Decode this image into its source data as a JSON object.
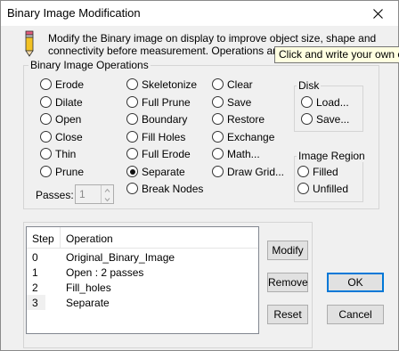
{
  "window": {
    "title": "Binary Image Modification"
  },
  "description": {
    "line1": "Modify the Binary image on display to improve object size, shape and",
    "line2": "connectivity before measurement. Operations are auto"
  },
  "tooltip": {
    "text": "Click and write your own c"
  },
  "operations": {
    "label": "Binary Image Operations",
    "col1": [
      "Erode",
      "Dilate",
      "Open",
      "Close",
      "Thin",
      "Prune"
    ],
    "col2": [
      "Skeletonize",
      "Full Prune",
      "Boundary",
      "Fill Holes",
      "Full Erode",
      "Separate",
      "Break Nodes"
    ],
    "col3": [
      "Clear",
      "Save",
      "Restore",
      "Exchange",
      "Math...",
      "Draw Grid..."
    ],
    "selected": "Separate"
  },
  "disk": {
    "label": "Disk",
    "load": "Load...",
    "save": "Save..."
  },
  "image_region": {
    "label": "Image Region",
    "filled": "Filled",
    "unfilled": "Unfilled"
  },
  "passes": {
    "label": "Passes:",
    "value": "1"
  },
  "list": {
    "headers": [
      "Step",
      "Operation"
    ],
    "rows": [
      {
        "step": "0",
        "operation": "Original_Binary_Image"
      },
      {
        "step": "1",
        "operation": "Open : 2 passes"
      },
      {
        "step": "2",
        "operation": "Fill_holes"
      },
      {
        "step": "3",
        "operation": "Separate"
      }
    ]
  },
  "buttons": {
    "modify": "Modify",
    "remove": "Remove",
    "reset": "Reset",
    "ok": "OK",
    "cancel": "Cancel"
  }
}
